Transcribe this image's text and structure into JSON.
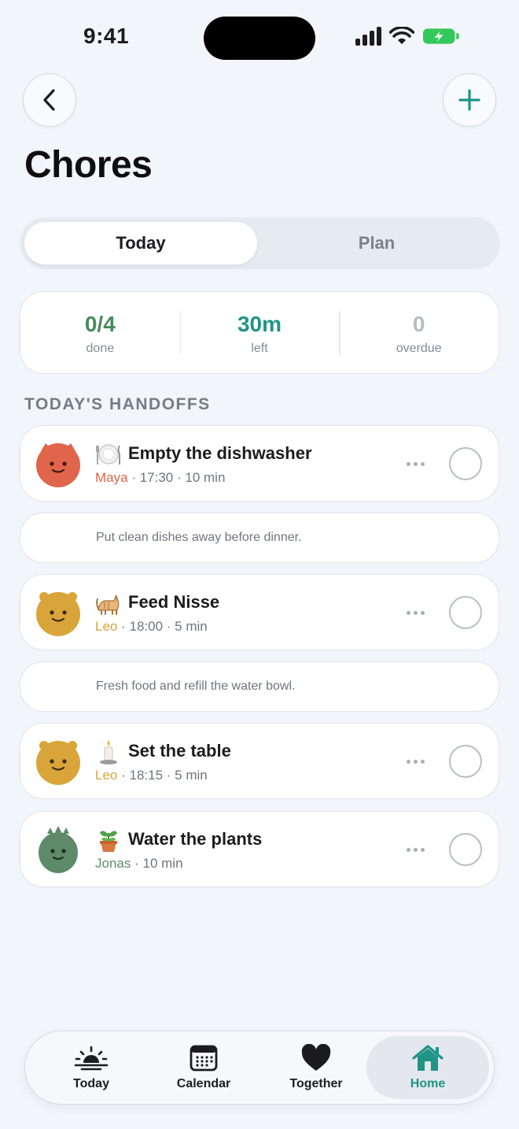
{
  "status": {
    "time": "9:41"
  },
  "header": {
    "title": "Chores"
  },
  "segments": {
    "active": "Today",
    "inactive": "Plan"
  },
  "stats": [
    {
      "value": "0/4",
      "label": "done"
    },
    {
      "value": "30m",
      "label": "left"
    },
    {
      "value": "0",
      "label": "overdue"
    }
  ],
  "section": {
    "title": "TODAY'S HANDOFFS"
  },
  "chores": [
    {
      "name": "Empty the dishwasher",
      "person": "Maya",
      "time": "17:30",
      "duration": "10 min",
      "note": "Put clean dishes away before dinner.",
      "person_color": "#e0654a"
    },
    {
      "name": "Feed Nisse",
      "person": "Leo",
      "time": "18:00",
      "duration": "5 min",
      "note": "Fresh food and refill the water bowl.",
      "person_color": "#d9a53a"
    },
    {
      "name": "Set the table",
      "person": "Leo",
      "time": "18:15",
      "duration": "5 min",
      "person_color": "#d9a53a"
    },
    {
      "name": "Water the plants",
      "person": "Jonas",
      "duration": "10 min",
      "person_color": "#5e8a6a"
    }
  ],
  "tabs": [
    {
      "label": "Today",
      "icon": "sunrise-icon"
    },
    {
      "label": "Calendar",
      "icon": "calendar-icon"
    },
    {
      "label": "Together",
      "icon": "heart-icon"
    },
    {
      "label": "Home",
      "icon": "house-icon"
    }
  ],
  "colors": {
    "accent": "#1f9487",
    "background": "#f2f5fa"
  }
}
